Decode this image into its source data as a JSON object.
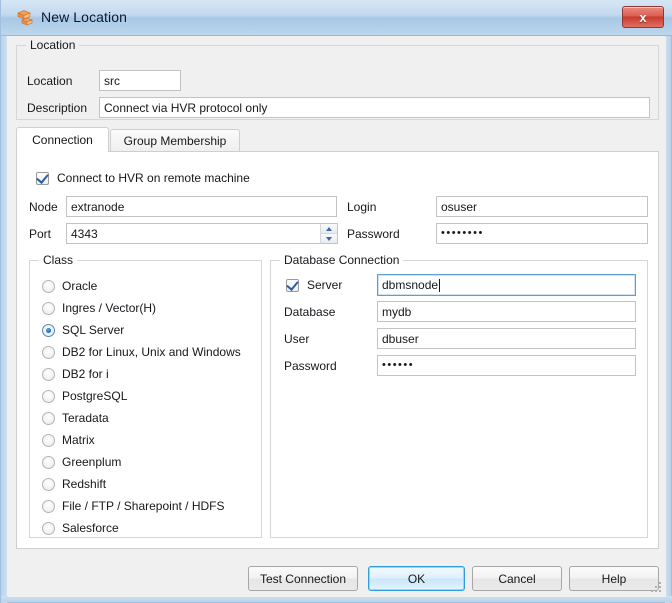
{
  "window": {
    "title": "New Location",
    "icon": "locations-icon",
    "close_label": "x",
    "close_icon": "close-icon"
  },
  "location_group": {
    "title": "Location",
    "fields": [
      {
        "label": "Location",
        "value": "src"
      },
      {
        "label": "Description",
        "value": "Connect via HVR protocol only"
      }
    ]
  },
  "tabs": [
    {
      "label": "Connection",
      "active": true
    },
    {
      "label": "Group Membership",
      "active": false
    }
  ],
  "connection": {
    "remote_checkbox": {
      "label": "Connect to HVR on remote machine",
      "checked": true
    },
    "node": {
      "label": "Node",
      "value": "extranode"
    },
    "login": {
      "label": "Login",
      "value": "osuser"
    },
    "port": {
      "label": "Port",
      "value": "4343",
      "spinner": true
    },
    "password": {
      "label": "Password",
      "value": "••••••••",
      "masked": true
    }
  },
  "class_group": {
    "title": "Class",
    "selected": "SQL Server",
    "options": [
      "Oracle",
      "Ingres / Vector(H)",
      "SQL Server",
      "DB2 for Linux, Unix and Windows",
      "DB2 for i",
      "PostgreSQL",
      "Teradata",
      "Matrix",
      "Greenplum",
      "Redshift",
      "File / FTP / Sharepoint / HDFS",
      "Salesforce"
    ]
  },
  "database_group": {
    "title": "Database Connection",
    "server": {
      "label": "Server",
      "checked": true,
      "value": "dbmsnode",
      "focused": true
    },
    "database": {
      "label": "Database",
      "value": "mydb"
    },
    "user": {
      "label": "User",
      "value": "dbuser"
    },
    "password": {
      "label": "Password",
      "value": "••••••",
      "masked": true
    }
  },
  "buttons": [
    {
      "label": "Test Connection",
      "default": false
    },
    {
      "label": "OK",
      "default": true
    },
    {
      "label": "Cancel",
      "default": false
    },
    {
      "label": "Help",
      "default": false
    }
  ],
  "colors": {
    "titlebar_start": "#d7e6f4",
    "titlebar_end": "#bcd6ec",
    "frame": "#9fc0e0",
    "close_red": "#c83a2c",
    "default_button_border": "#2f9ddb",
    "radio_accent": "#1a63b0",
    "focus_border": "#5d9ed4",
    "dialog_bg": "#f0f0f0"
  }
}
